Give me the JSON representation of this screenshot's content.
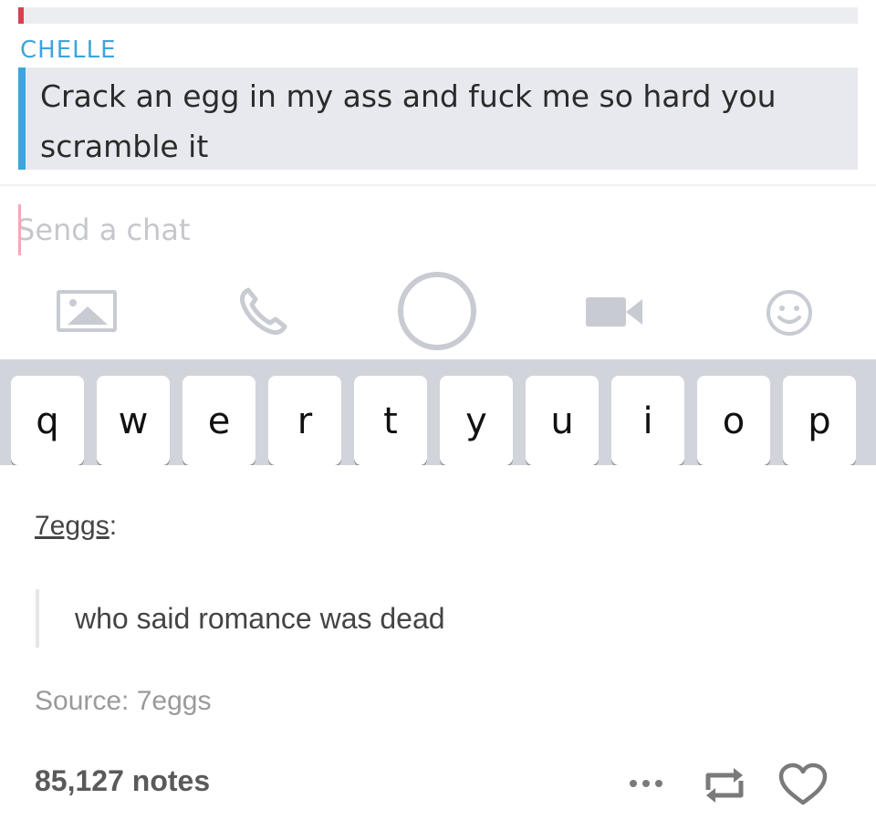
{
  "snapchat": {
    "sender": "CHELLE",
    "message": "Crack an egg in my ass and fuck me so hard you scramble it",
    "input_placeholder": "Send a chat",
    "toolbar_icons": [
      "image-icon",
      "phone-icon",
      "capture-button",
      "video-icon",
      "smile-icon"
    ],
    "keys": [
      "q",
      "w",
      "e",
      "r",
      "t",
      "y",
      "u",
      "i",
      "o",
      "p"
    ],
    "colors": {
      "sender": "#3ea4dc",
      "message_bar": "#3ea4dc",
      "prev_bar": "#d9404f",
      "cursor": "#f2a9b9"
    }
  },
  "tumblr": {
    "username": "7eggs",
    "username_suffix": ":",
    "reply": "who said romance was dead",
    "source_label": "Source: ",
    "source_name": "7eggs",
    "notes": "85,127 notes",
    "actions": [
      "more-icon",
      "reblog-icon",
      "heart-icon"
    ]
  }
}
